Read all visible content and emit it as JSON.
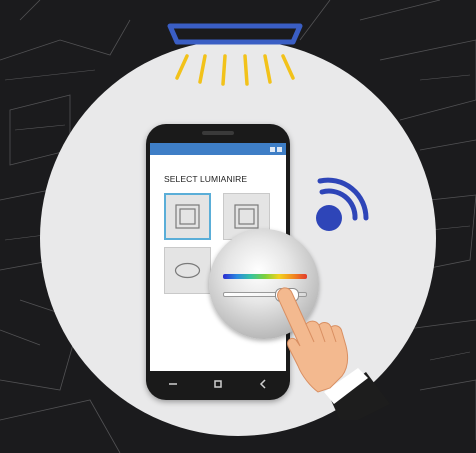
{
  "screen": {
    "title": "SELECT LUMIANIRE"
  },
  "colors": {
    "circle": "#e9e9ea",
    "lamp_frame": "#3a5ec4",
    "lamp_rays": "#f2c21a",
    "wireless": "#2e45b8",
    "status_bar": "#3e7ec6",
    "selected_tile": "#5aaed8",
    "sleeve": "#1d1d1d",
    "skin": "#f3b98f"
  },
  "icons": {
    "lamp": "ceiling-light-icon",
    "wireless": "wireless-signal-icon",
    "nav_back": "back-icon",
    "nav_home": "home-icon",
    "nav_recent": "recent-apps-icon"
  }
}
